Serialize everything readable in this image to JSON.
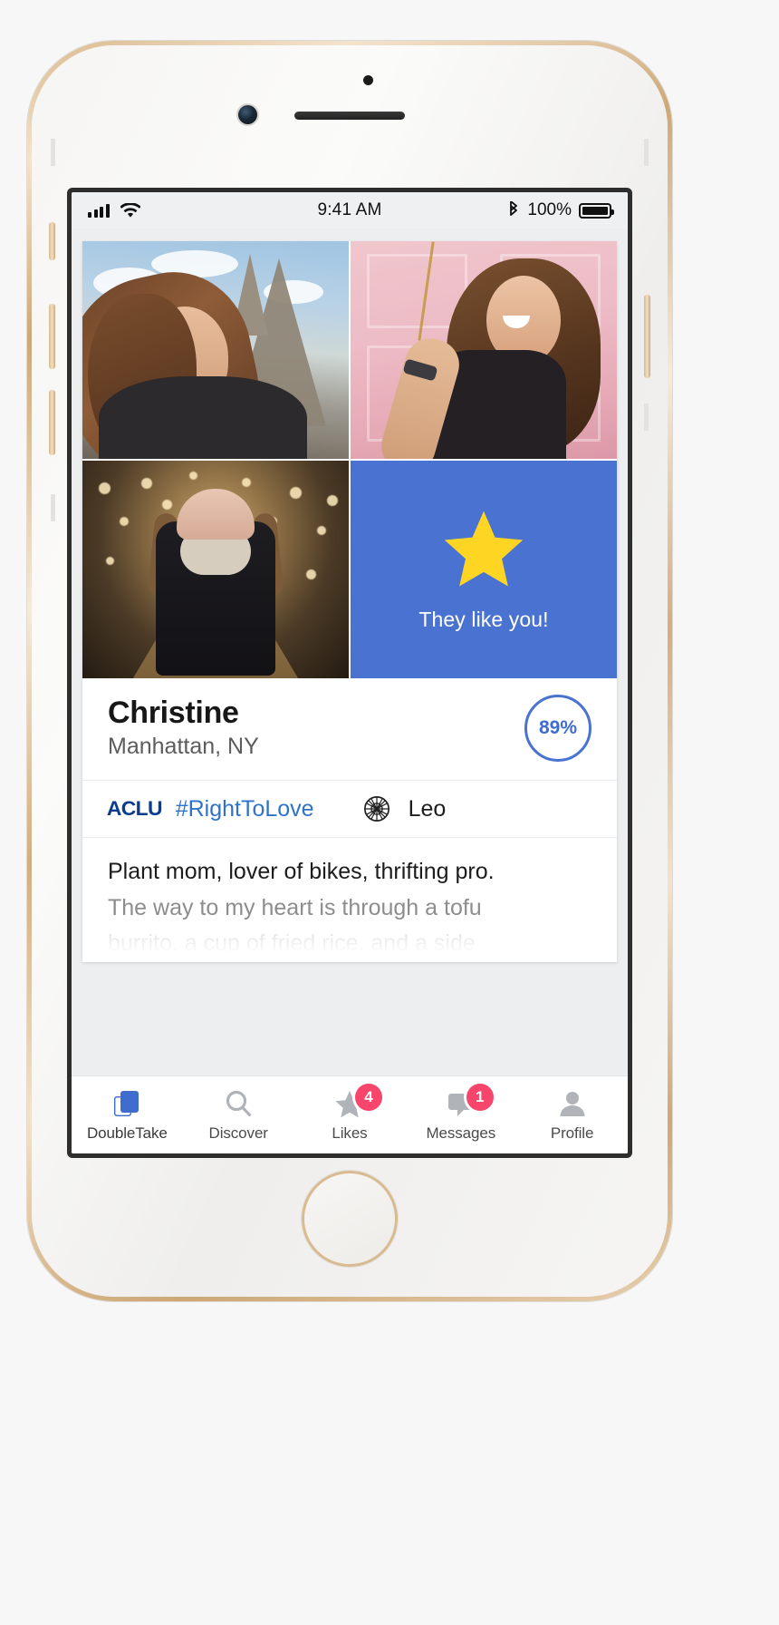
{
  "statusbar": {
    "signal_icon": "cellular-bars-icon",
    "wifi_icon": "wifi-icon",
    "time": "9:41 AM",
    "bluetooth_icon": "bluetooth-icon",
    "battery_percent": "100%",
    "battery_icon": "battery-full-icon"
  },
  "card": {
    "photos": [
      {
        "alt": "woman smiling in front of eiffel tower"
      },
      {
        "alt": "woman laughing in front of pink door"
      },
      {
        "alt": "woman in beanie in light tunnel"
      }
    ],
    "like_panel": {
      "icon": "star-icon",
      "text": "They like you!",
      "bg_color": "#4a72d0",
      "star_color": "#ffd524"
    },
    "profile": {
      "name": "Christine",
      "location": "Manhattan, NY",
      "match_percent": "89%",
      "match_color": "#4a72d0"
    },
    "badges": {
      "org_label": "ACLU",
      "org_color": "#0b3c91",
      "hashtag": "#RightToLove",
      "hashtag_color": "#2f73c9",
      "zodiac_icon": "zodiac-wheel-icon",
      "zodiac_sign": "Leo"
    },
    "bio": {
      "line1": "Plant mom, lover of bikes, thrifting pro.",
      "line2": "The way to my heart is through a tofu",
      "line3": "burrito, a cup of fried rice, and a side"
    }
  },
  "tabbar": {
    "tabs": [
      {
        "label": "DoubleTake",
        "icon": "stacked-cards-icon",
        "active": true,
        "badge": ""
      },
      {
        "label": "Discover",
        "icon": "search-icon",
        "active": false,
        "badge": ""
      },
      {
        "label": "Likes",
        "icon": "star-icon",
        "active": false,
        "badge": "4"
      },
      {
        "label": "Messages",
        "icon": "chat-bubble-icon",
        "active": false,
        "badge": "1"
      },
      {
        "label": "Profile",
        "icon": "person-icon",
        "active": false,
        "badge": ""
      }
    ],
    "active_color": "#3f6ccd",
    "inactive_color": "#b0b3b8",
    "badge_color": "#f8456b"
  }
}
